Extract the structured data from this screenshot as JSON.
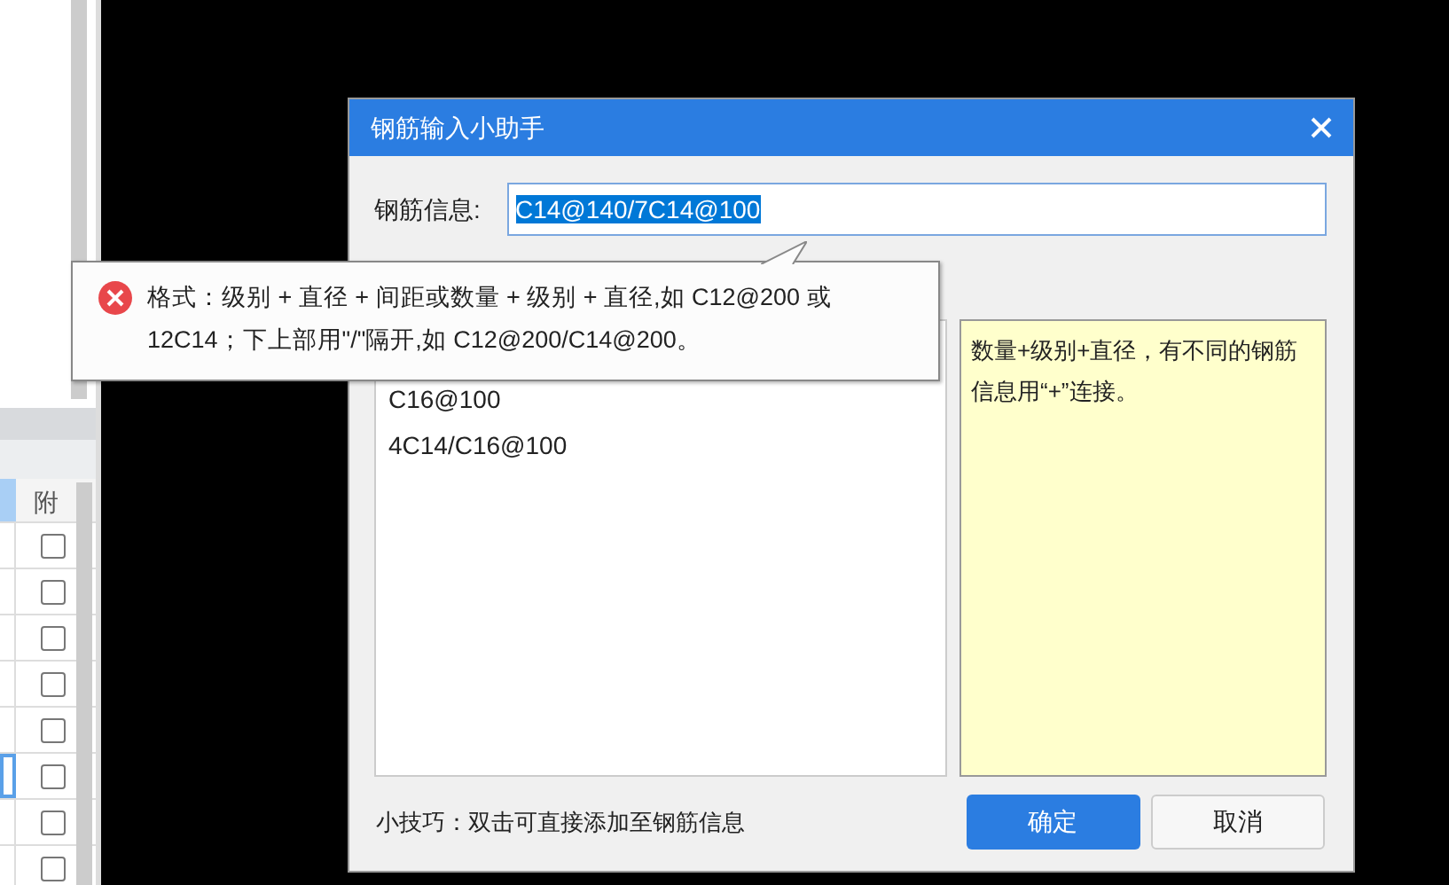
{
  "background_window": {
    "column_header": "附",
    "rows": [
      {
        "checked": false,
        "selected": false
      },
      {
        "checked": false,
        "selected": false
      },
      {
        "checked": false,
        "selected": false
      },
      {
        "checked": false,
        "selected": false
      },
      {
        "checked": false,
        "selected": false
      },
      {
        "checked": false,
        "selected": true
      },
      {
        "checked": false,
        "selected": false
      },
      {
        "checked": false,
        "selected": false
      }
    ]
  },
  "dialog": {
    "title": "钢筋输入小助手",
    "field_label": "钢筋信息:",
    "field_value": "C14@140/7C14@100",
    "field_text_selected": true,
    "list_items": [
      "C16@100",
      "4C14/C16@100"
    ],
    "note": "数量+级别+直径，有不同的钢筋信息用“+”连接。",
    "tip": "小技巧：双击可直接添加至钢筋信息",
    "buttons": [
      {
        "label": "确定",
        "kind": "primary"
      },
      {
        "label": "取消",
        "kind": "secondary"
      }
    ]
  },
  "tooltip": {
    "text": "格式：级别 + 直径 + 间距或数量 + 级别 + 直径,如 C12@200 或 12C14；下上部用\"/\"隔开,如 C12@200/C14@200。"
  }
}
